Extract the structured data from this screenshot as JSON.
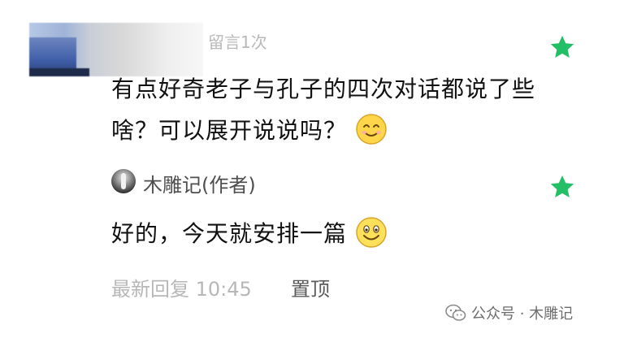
{
  "top_comment": {
    "meta": "留言1次",
    "text": "有点好奇老子与孔子的四次对话都说了些啥？可以展开说说吗？",
    "emoji": "smile-emoji",
    "starred": true
  },
  "reply": {
    "author": "木雕记(作者)",
    "text": "好的，今天就安排一篇",
    "emoji": "smile-emoji",
    "starred": true
  },
  "footer": {
    "timestamp": "最新回复 10:45",
    "pin_label": "置顶"
  },
  "watermark": {
    "text": "公众号 · 木雕记"
  },
  "colors": {
    "star": "#22bf67",
    "meta": "#b9b9b9",
    "text": "#111111"
  }
}
